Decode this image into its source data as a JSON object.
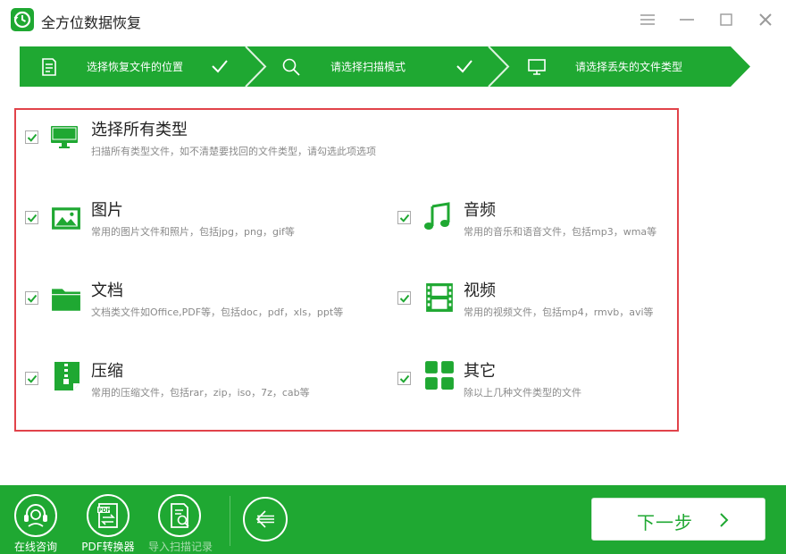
{
  "window": {
    "title": "全方位数据恢复",
    "menu_icon": "menu-icon",
    "minimize_icon": "minimize-icon",
    "maximize_icon": "maximize-icon",
    "close_icon": "close-icon"
  },
  "steps": [
    {
      "label": "选择恢复文件的位置",
      "icon": "document-icon",
      "done": true
    },
    {
      "label": "请选择扫描模式",
      "icon": "search-icon",
      "done": true
    },
    {
      "label": "请选择丢失的文件类型",
      "icon": "monitor-icon",
      "done": false
    }
  ],
  "options": {
    "all": {
      "title": "选择所有类型",
      "desc": "扫描所有类型文件，如不清楚要找回的文件类型，请勾选此项选项",
      "checked": true,
      "icon": "monitor-icon"
    },
    "image": {
      "title": "图片",
      "desc": "常用的图片文件和照片，包括jpg，png，gif等",
      "checked": true,
      "icon": "image-icon"
    },
    "audio": {
      "title": "音频",
      "desc": "常用的音乐和语音文件，包括mp3，wma等",
      "checked": true,
      "icon": "music-note-icon"
    },
    "doc": {
      "title": "文档",
      "desc": "文档类文件如Office,PDF等，包括doc，pdf，xls，ppt等",
      "checked": true,
      "icon": "folder-icon"
    },
    "video": {
      "title": "视频",
      "desc": "常用的视频文件，包括mp4，rmvb，avi等",
      "checked": true,
      "icon": "film-icon"
    },
    "zip": {
      "title": "压缩",
      "desc": "常用的压缩文件，包括rar，zip，iso，7z，cab等",
      "checked": true,
      "icon": "zip-file-icon"
    },
    "other": {
      "title": "其它",
      "desc": "除以上几种文件类型的文件",
      "checked": true,
      "icon": "grid-icon"
    }
  },
  "footer": {
    "tools": [
      {
        "label": "在线咨询",
        "icon": "headset-icon"
      },
      {
        "label": "PDF转换器",
        "icon": "pdf-convert-icon"
      },
      {
        "label": "导入扫描记录",
        "icon": "import-record-icon"
      }
    ],
    "back_icon": "back-arrow-icon",
    "next_label": "下一步",
    "next_icon": "chevron-right-icon"
  },
  "colors": {
    "brand_green": "#1fa832",
    "highlight_red": "#e1434a"
  }
}
